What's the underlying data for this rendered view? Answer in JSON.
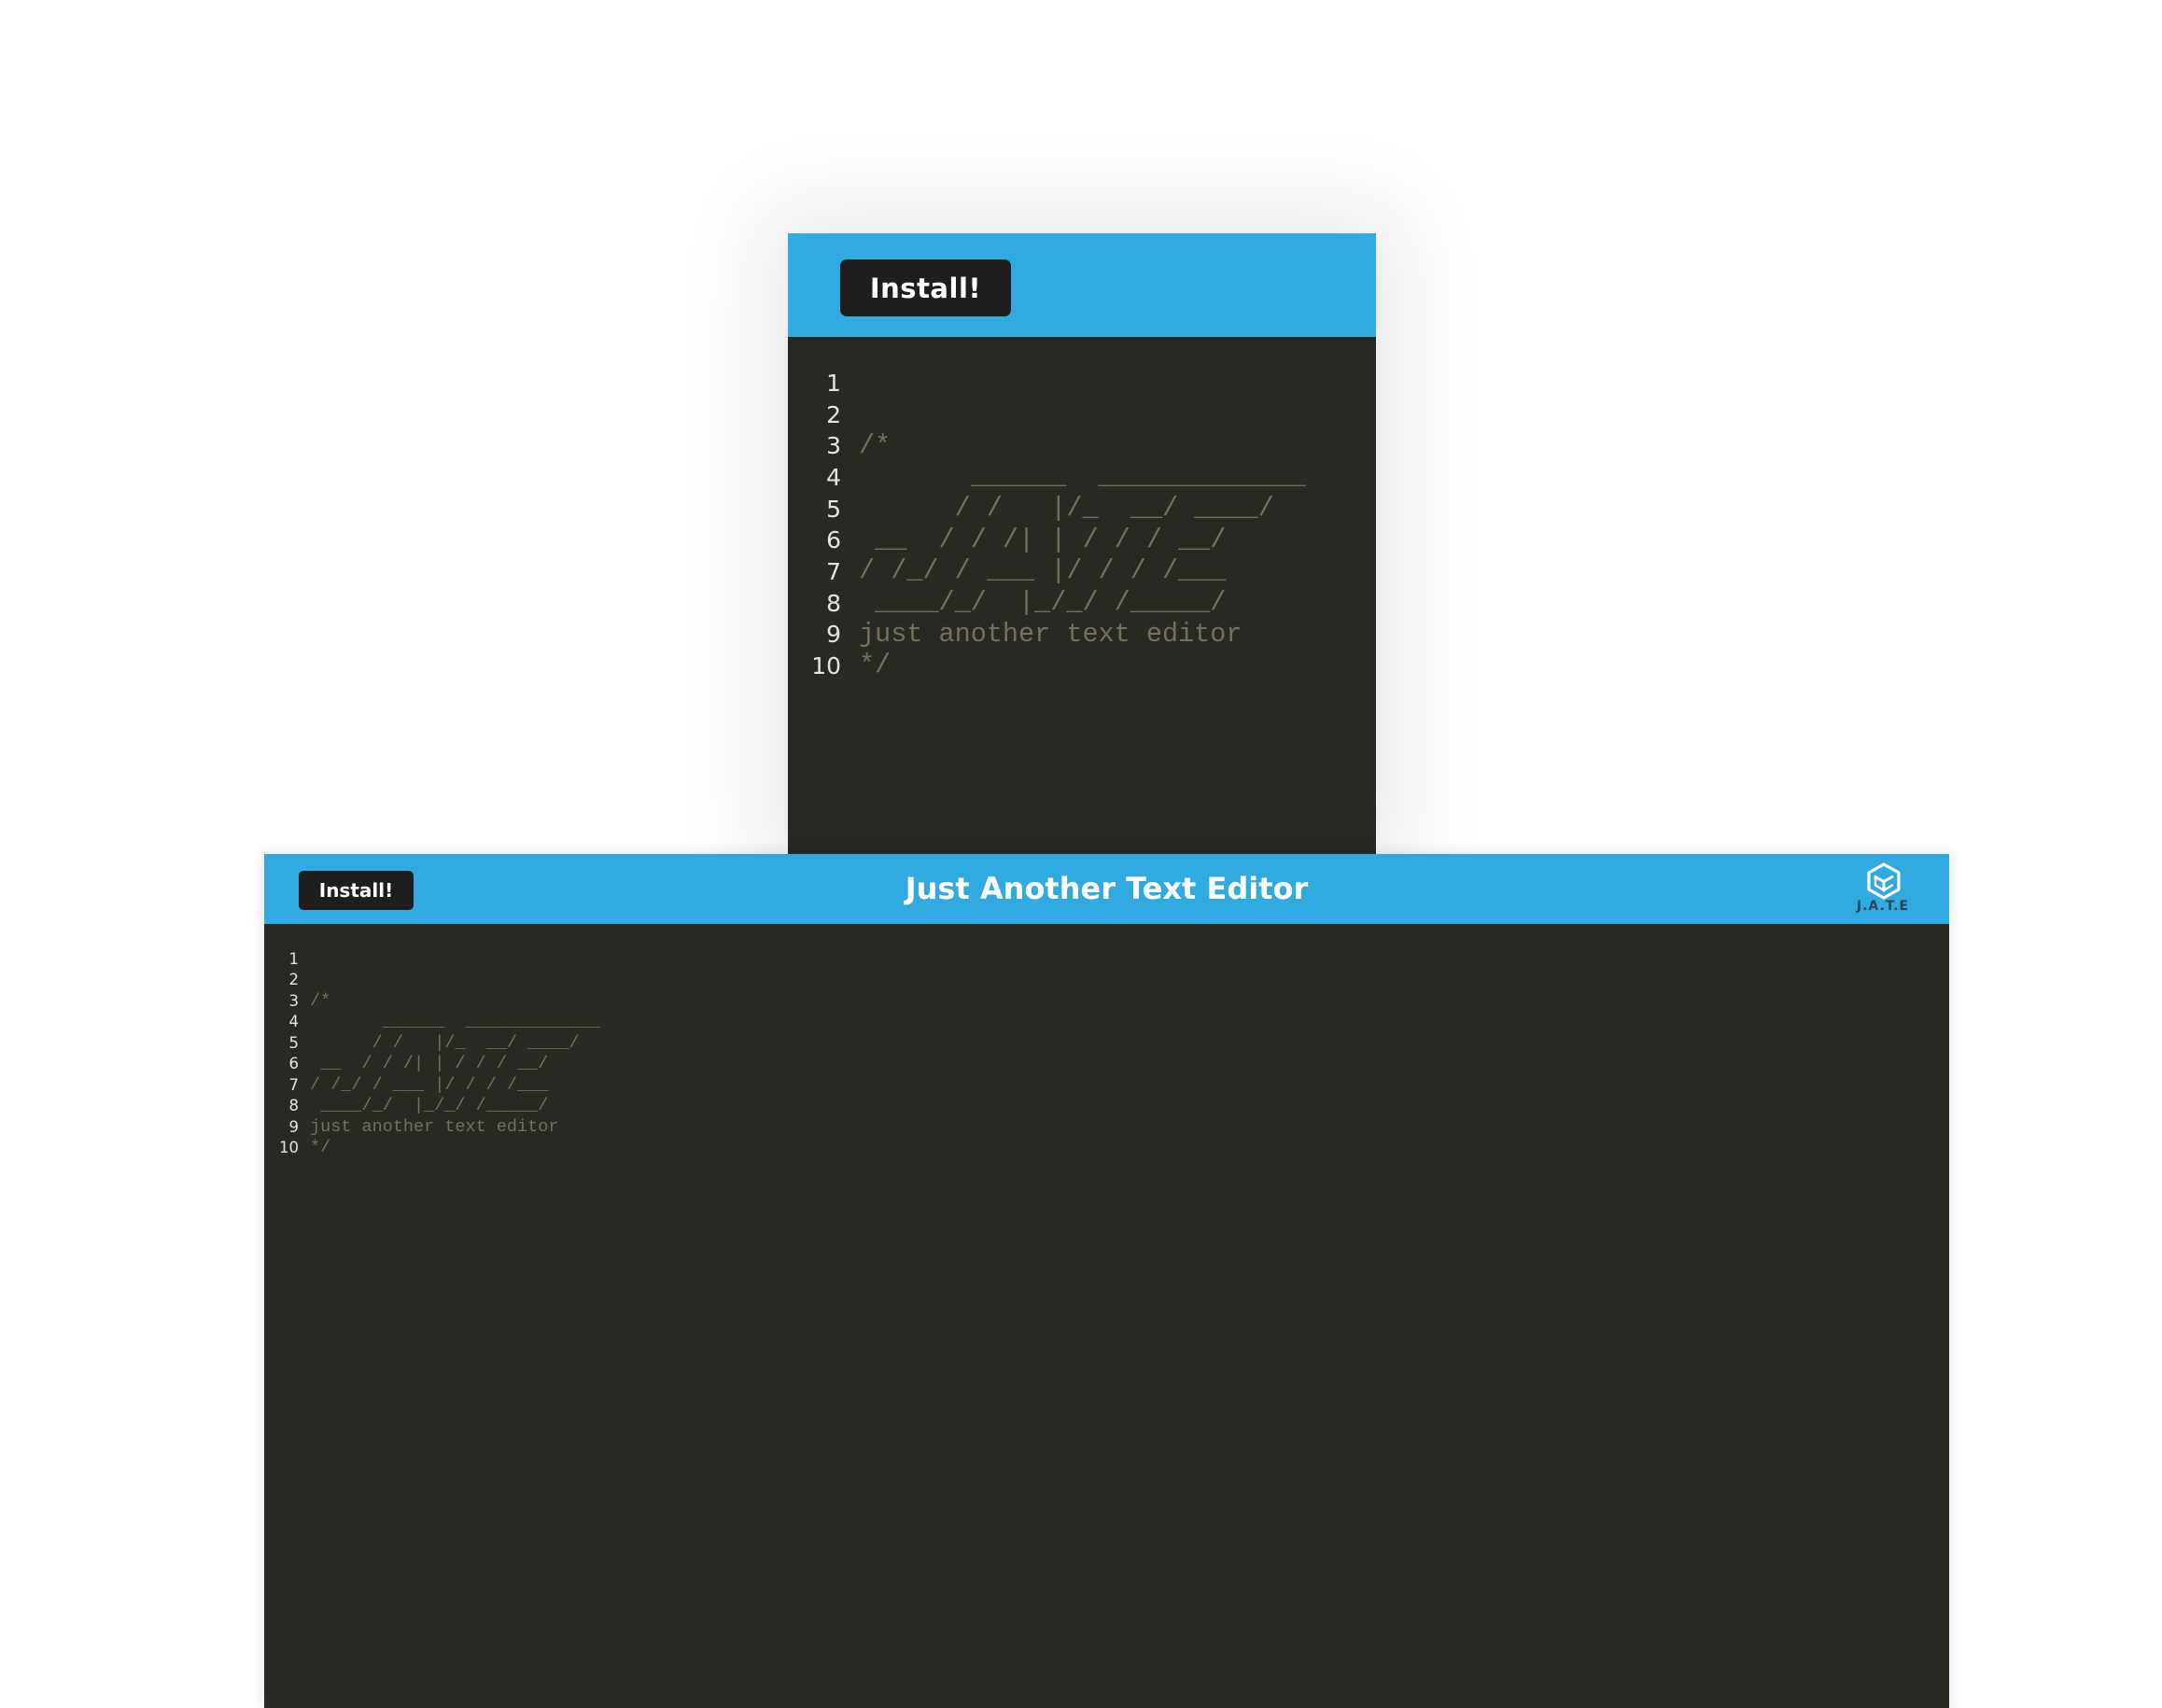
{
  "mobile": {
    "install_label": "Install!"
  },
  "desktop": {
    "install_label": "Install!",
    "title": "Just Another Text Editor",
    "logo_text": "J.A.T.E"
  },
  "editor": {
    "lines": [
      {
        "number": "1",
        "text": ""
      },
      {
        "number": "2",
        "text": "/*"
      },
      {
        "number": "3",
        "text": "       ______  _____________"
      },
      {
        "number": "4",
        "text": "      / /   |/_  __/ ____/"
      },
      {
        "number": "5",
        "text": " __  / / /| | / / / __/"
      },
      {
        "number": "6",
        "text": "/ /_/ / ___ |/ / / /___"
      },
      {
        "number": "7",
        "text": " ____/_/  |_/_/ /_____/"
      },
      {
        "number": "8",
        "text": "just another text editor"
      },
      {
        "number": "9",
        "text": "*/"
      },
      {
        "number": "10",
        "text": ""
      }
    ]
  },
  "colors": {
    "header_bg": "#31a9e1",
    "editor_bg": "#282923",
    "button_bg": "#1e1e1e",
    "comment_text": "#75715e",
    "gutter_text": "#e4e4e4",
    "logo_color": "#2d4457"
  },
  "icons": {
    "logo": "jate-cube-logo-icon"
  }
}
